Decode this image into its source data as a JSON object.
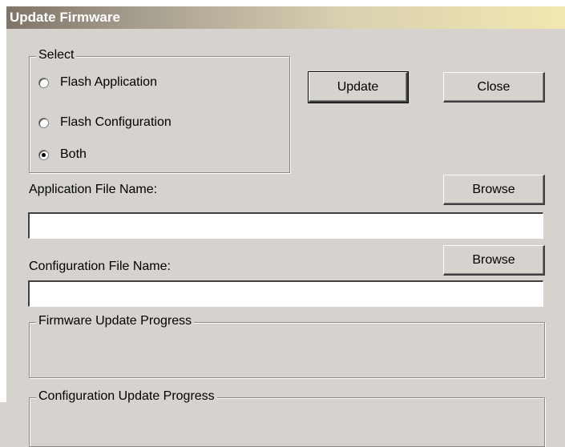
{
  "window": {
    "title": "Update Firmware"
  },
  "select_group": {
    "label": "Select",
    "options": [
      {
        "label": "Flash Application",
        "selected": false
      },
      {
        "label": "Flash Configuration",
        "selected": false
      },
      {
        "label": "Both",
        "selected": true
      }
    ]
  },
  "buttons": {
    "update": "Update",
    "close": "Close",
    "browse_app": "Browse",
    "browse_config": "Browse"
  },
  "application_file": {
    "label": "Application File Name:",
    "value": ""
  },
  "configuration_file": {
    "label": "Configuration File Name:",
    "value": ""
  },
  "firmware_progress": {
    "label": "Firmware Update Progress"
  },
  "configuration_progress": {
    "label": "Configuration Update Progress"
  }
}
